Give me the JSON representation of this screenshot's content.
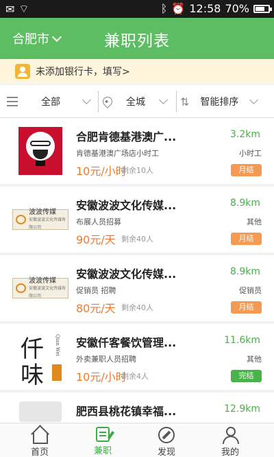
{
  "statusbar": {
    "time": "12:58",
    "battery": "70%",
    "battery_level": 0.7
  },
  "header": {
    "city": "合肥市",
    "title": "兼职列表"
  },
  "notice": {
    "text": "未添加银行卡，填写>"
  },
  "filter": {
    "category": "全部",
    "area": "全城",
    "sort": "智能排序"
  },
  "jobs": [
    {
      "name": "合肥肯德基港澳广...",
      "distance": "3.2km",
      "desc": "肯德基港澳广场店小时工",
      "type": "小时工",
      "salary": "10元/小时",
      "remain": "剩余10人",
      "settle": "月结",
      "settle_color": "#f59a53"
    },
    {
      "name": "安徽波波文化传媒...",
      "distance": "8.9km",
      "desc": "布展人员招募",
      "type": "其他",
      "salary": "90元/天",
      "remain": "剩余40人",
      "settle": "月结",
      "settle_color": "#f59a53"
    },
    {
      "name": "安徽波波文化传媒...",
      "distance": "8.9km",
      "desc": "促销员  招聘",
      "type": "促销员",
      "salary": "80元/天",
      "remain": "剩余40人",
      "settle": "月结",
      "settle_color": "#f59a53"
    },
    {
      "name": "安徽仟客餐饮管理...",
      "distance": "11.6km",
      "desc": "外卖兼职人员招聘",
      "type": "其他",
      "salary": "10元/小时",
      "remain": "剩余4人",
      "settle": "完结",
      "settle_color": "#49b349"
    },
    {
      "name": "肥西县桃花镇幸福...",
      "distance": "12.9km"
    }
  ],
  "logos": {
    "bobo_text": "波波传媒",
    "bobo_sub": "安徽波波文化传媒有限公司",
    "qian_c1": "仟",
    "qian_c2": "味",
    "qian_en": "Qian Wei"
  },
  "tabs": [
    {
      "label": "首页",
      "icon": "home-icon"
    },
    {
      "label": "兼职",
      "icon": "job-icon"
    },
    {
      "label": "发现",
      "icon": "discover-icon"
    },
    {
      "label": "我的",
      "icon": "profile-icon"
    }
  ],
  "colors": {
    "accent": "#5cbd62",
    "salary": "#f07a2c",
    "distance": "#4cae4c"
  }
}
